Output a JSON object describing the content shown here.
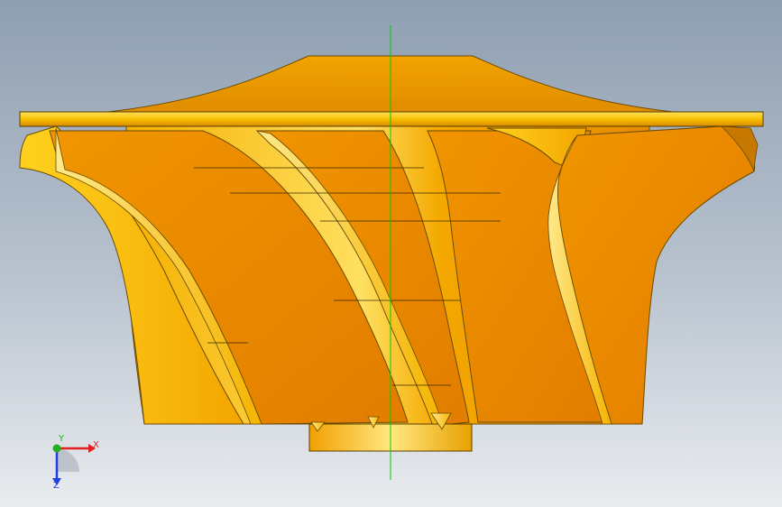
{
  "viewport": {
    "model": "impeller",
    "background": [
      "#8f9fb1",
      "#e9ecef"
    ],
    "model_color": "#f0a000",
    "section_line_color": "#00cc00"
  },
  "triad": {
    "x_label": "X",
    "y_label": "Y",
    "z_label": "Z",
    "x_color": "#e02020",
    "y_color": "#20b020",
    "z_color": "#2040e0"
  }
}
